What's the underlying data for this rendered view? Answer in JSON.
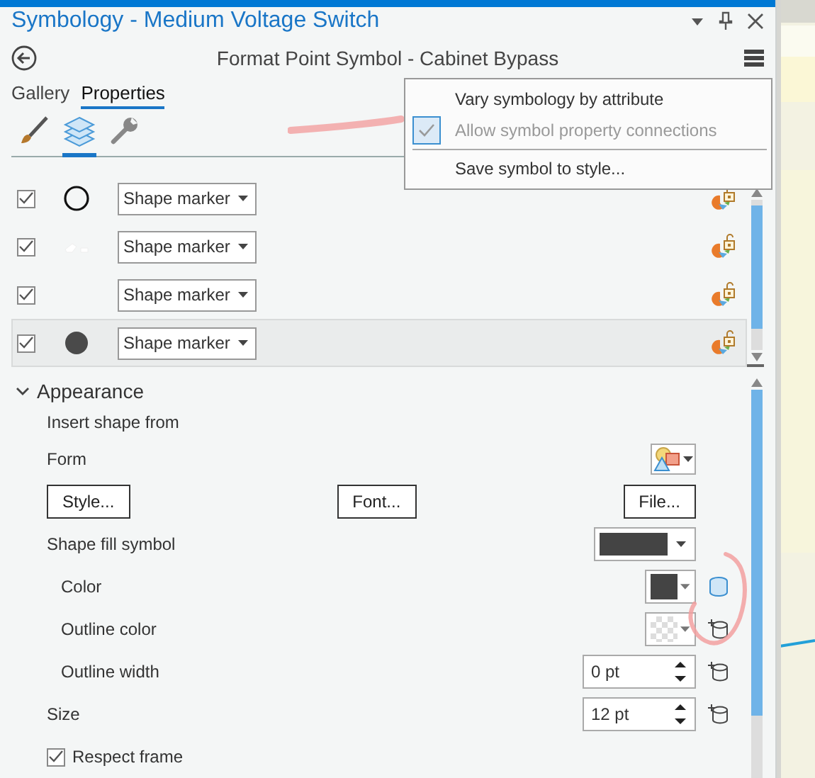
{
  "window": {
    "title": "Symbology - Medium Voltage Switch"
  },
  "header": {
    "title": "Format Point Symbol - Cabinet Bypass"
  },
  "tabs": [
    {
      "label": "Gallery",
      "selected": false
    },
    {
      "label": "Properties",
      "selected": true
    }
  ],
  "tool_tabs": [
    {
      "kind": "brush",
      "selected": false
    },
    {
      "kind": "layers",
      "selected": true
    },
    {
      "kind": "wrench",
      "selected": false
    }
  ],
  "menu": {
    "groups": [
      [
        {
          "label": "Vary symbology by attribute",
          "checked": false,
          "disabled": false
        },
        {
          "label": "Allow symbol property connections",
          "checked": true,
          "disabled": true
        }
      ],
      [
        {
          "label": "Save symbol to style...",
          "checked": false,
          "disabled": false
        }
      ]
    ]
  },
  "layers": [
    {
      "visible": true,
      "kind": "ring",
      "type": "Shape marker",
      "selected": false
    },
    {
      "visible": true,
      "kind": "sketch",
      "type": "Shape marker",
      "selected": false
    },
    {
      "visible": true,
      "kind": "empty",
      "type": "Shape marker",
      "selected": false
    },
    {
      "visible": true,
      "kind": "dot",
      "type": "Shape marker",
      "selected": true
    }
  ],
  "appearance": {
    "title": "Appearance",
    "expanded": true,
    "rows": [
      {
        "kind": "label",
        "label": "Insert shape from"
      },
      {
        "kind": "form",
        "label": "Form"
      },
      {
        "kind": "buttons",
        "buttons": [
          "Style...",
          "Font...",
          "File..."
        ]
      },
      {
        "kind": "swatch",
        "label": "Shape fill symbol",
        "transparent": false,
        "children": [
          {
            "kind": "color",
            "label": "Color",
            "transparent": false,
            "connected": true
          },
          {
            "kind": "color",
            "label": "Outline color",
            "transparent": true,
            "connected": false
          },
          {
            "kind": "spin",
            "label": "Outline width",
            "value": "0 pt",
            "connected": false
          }
        ]
      },
      {
        "kind": "spin",
        "label": "Size",
        "value": "12 pt",
        "connected": false
      },
      {
        "kind": "checkbox",
        "label": "Respect frame",
        "checked": true
      }
    ]
  }
}
